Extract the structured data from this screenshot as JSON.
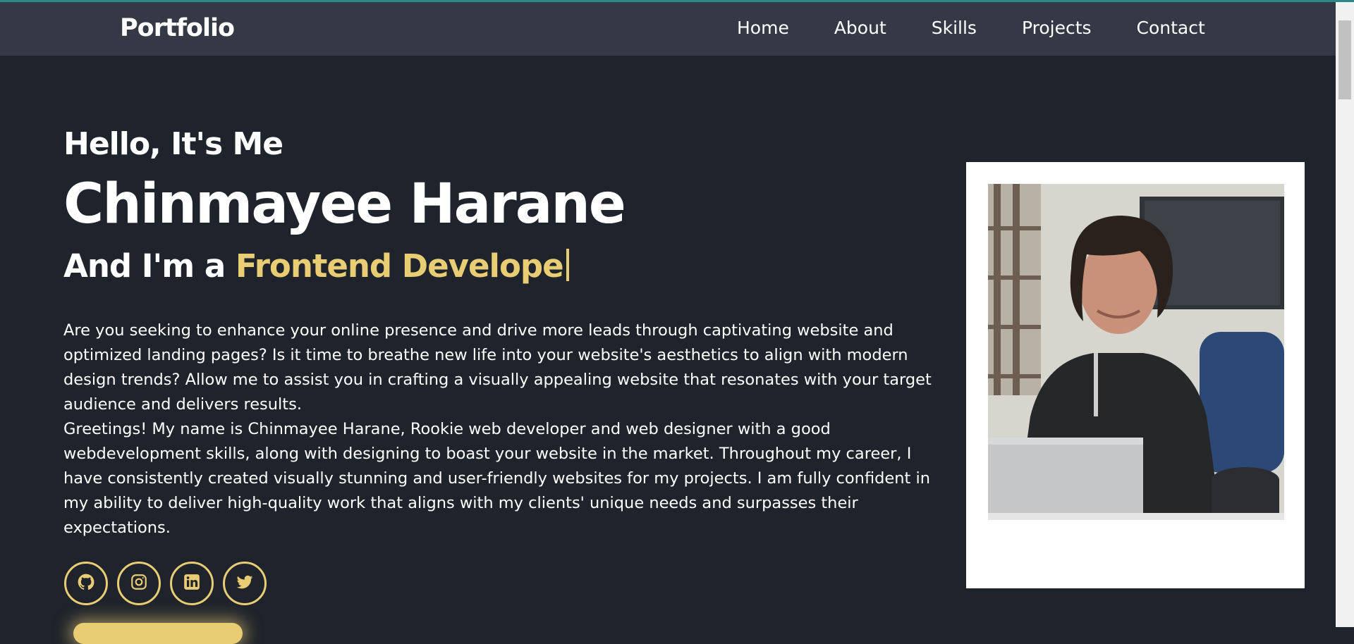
{
  "header": {
    "brand": "Portfolio",
    "nav": [
      {
        "label": "Home"
      },
      {
        "label": "About"
      },
      {
        "label": "Skills"
      },
      {
        "label": "Projects"
      },
      {
        "label": "Contact"
      }
    ]
  },
  "hero": {
    "greeting": "Hello, It's Me",
    "name": "Chinmayee Harane",
    "role_prefix": "And I'm a ",
    "role_typed": "Frontend Develope",
    "bio_paragraph_1": "Are you seeking to enhance your online presence and drive more leads through captivating website and optimized landing pages? Is it time to breathe new life into your website's aesthetics to align with modern design trends? Allow me to assist you in crafting a visually appealing website that resonates with your target audience and delivers results.",
    "bio_paragraph_2": "Greetings! My name is Chinmayee Harane, Rookie web developer and web designer with a good webdevelopment skills, along with designing to boast your website in the market. Throughout my career, I have consistently created visually stunning and user-friendly websites for my projects. I am fully confident in my ability to deliver high-quality work that aligns with my clients' unique needs and surpasses their expectations."
  },
  "socials": [
    {
      "icon": "github-icon"
    },
    {
      "icon": "instagram-icon"
    },
    {
      "icon": "linkedin-icon"
    },
    {
      "icon": "twitter-icon"
    }
  ],
  "colors": {
    "accent": "#e9cd74",
    "background": "#1f232b",
    "navbar": "#353945"
  }
}
